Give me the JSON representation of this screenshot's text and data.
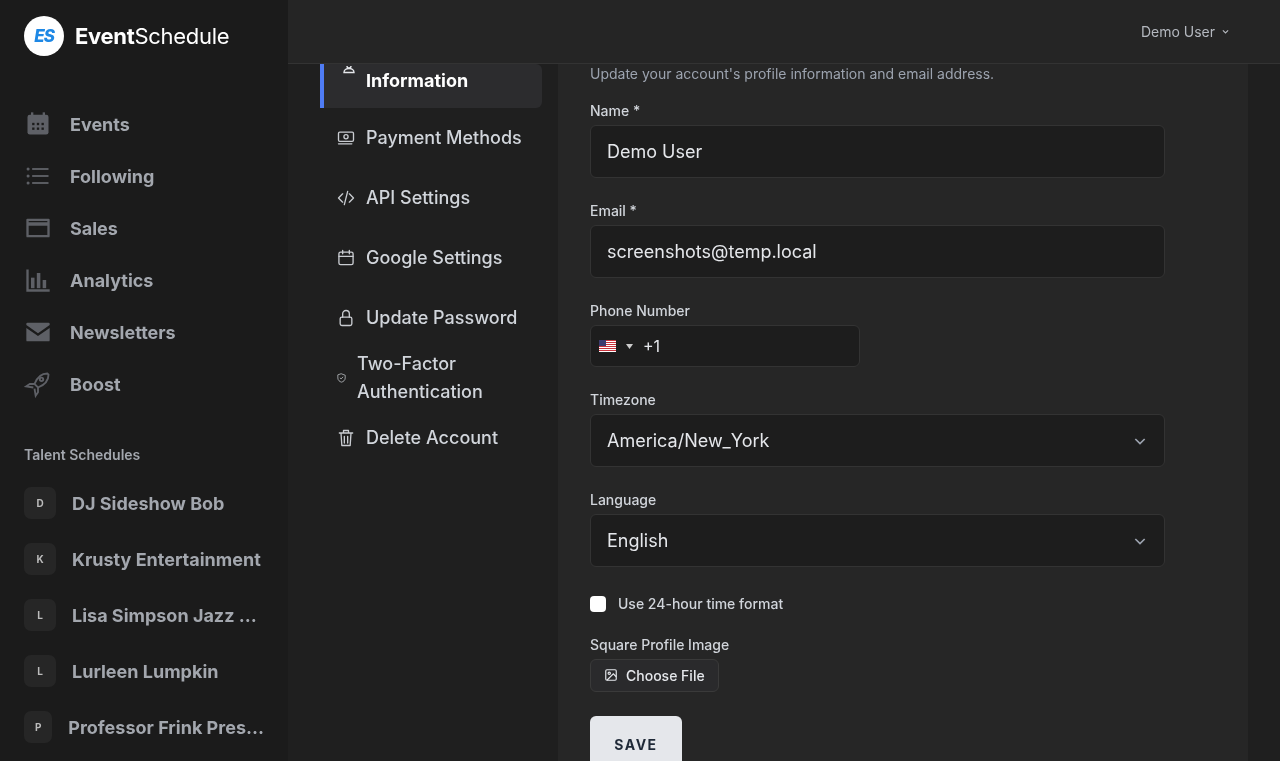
{
  "brand": {
    "logo": "ES",
    "name_bold": "Event",
    "name_light": "Schedule"
  },
  "nav": [
    {
      "label": "Events"
    },
    {
      "label": "Following"
    },
    {
      "label": "Sales"
    },
    {
      "label": "Analytics"
    },
    {
      "label": "Newsletters"
    },
    {
      "label": "Boost"
    }
  ],
  "talent": {
    "heading": "Talent Schedules",
    "items": [
      {
        "initial": "D",
        "name": "DJ Sideshow Bob"
      },
      {
        "initial": "K",
        "name": "Krusty Entertainment"
      },
      {
        "initial": "L",
        "name": "Lisa Simpson Jazz ..."
      },
      {
        "initial": "L",
        "name": "Lurleen Lumpkin"
      },
      {
        "initial": "P",
        "name": "Professor Frink Pres..."
      }
    ]
  },
  "user_menu": {
    "label": "Demo User"
  },
  "settings_nav": [
    {
      "label": "Information",
      "selected": true
    },
    {
      "label": "Payment Methods",
      "selected": false
    },
    {
      "label": "API Settings",
      "selected": false
    },
    {
      "label": "Google Settings",
      "selected": false
    },
    {
      "label": "Update Password",
      "selected": false
    },
    {
      "label": "Two-Factor Authentication",
      "selected": false
    },
    {
      "label": "Delete Account",
      "selected": false
    }
  ],
  "form": {
    "description": "Update your account's profile information and email address.",
    "fields": [
      {
        "kind": "text",
        "label": "Name *",
        "value": "Demo User"
      },
      {
        "kind": "text",
        "label": "Email *",
        "value": "screenshots@temp.local"
      },
      {
        "kind": "phone",
        "label": "Phone Number",
        "value": "+1"
      },
      {
        "kind": "select",
        "label": "Timezone",
        "value": "America/New_York"
      },
      {
        "kind": "select",
        "label": "Language",
        "value": "English"
      }
    ],
    "time_format": {
      "label": "Use 24-hour time format",
      "checked": false
    },
    "image": {
      "label": "Square Profile Image",
      "button": "Choose File"
    },
    "save": "SAVE"
  }
}
